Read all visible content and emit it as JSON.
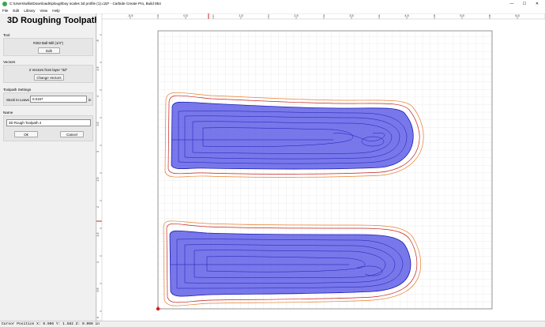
{
  "window": {
    "title": "C:\\Users\\willa\\Downloads\\ploughboy scales 3d profile (1).c2d* - Carbide Create Pro, Build 854",
    "minimize_glyph": "—",
    "maximize_glyph": "☐",
    "close_glyph": "✕"
  },
  "menu": [
    "File",
    "Edit",
    "Library",
    "View",
    "Help"
  ],
  "panel": {
    "title": "3D Roughing Toolpath",
    "tool_section": "Tool",
    "tool_name": "#202 Ball Mill (1/4\")",
    "edit_button": "Edit",
    "vectors_section": "Vectors",
    "vectors_info": "2 Vectors from layer \"3d\"",
    "change_vectors_button": "Change Vectors",
    "settings_section": "Toolpath Settings",
    "stock_label": "Stock to Leave",
    "stock_value": "0.0197",
    "stock_unit": "in",
    "name_section": "Name",
    "name_value": "3D Rough Toolpath 4",
    "ok_button": "Ok",
    "cancel_button": "Cancel"
  },
  "ruler": {
    "h_ticks": [
      "-0.5",
      "0",
      "0.5",
      "1",
      "1.5",
      "2",
      "2.5",
      "3",
      "3.5",
      "4",
      "4.5",
      "5",
      "5.5",
      "6",
      "6.5"
    ],
    "v_ticks": [
      "-5",
      "4.5",
      "4",
      "3.5",
      "3",
      "2.5",
      "2",
      "1.5",
      "1",
      "0.5",
      "0"
    ]
  },
  "status": {
    "cursor": "Cursor Position X: 0.906 Y: 1.582 Z: 0.000 in"
  },
  "colors": {
    "toolpath_fill": "#5a5ae6",
    "toolpath_line": "#1a1ab4",
    "outline_orange": "#e87f2a",
    "outline_red": "#c81e1e",
    "grid": "#d6d6d6",
    "stock_border": "#7a7a7a"
  }
}
